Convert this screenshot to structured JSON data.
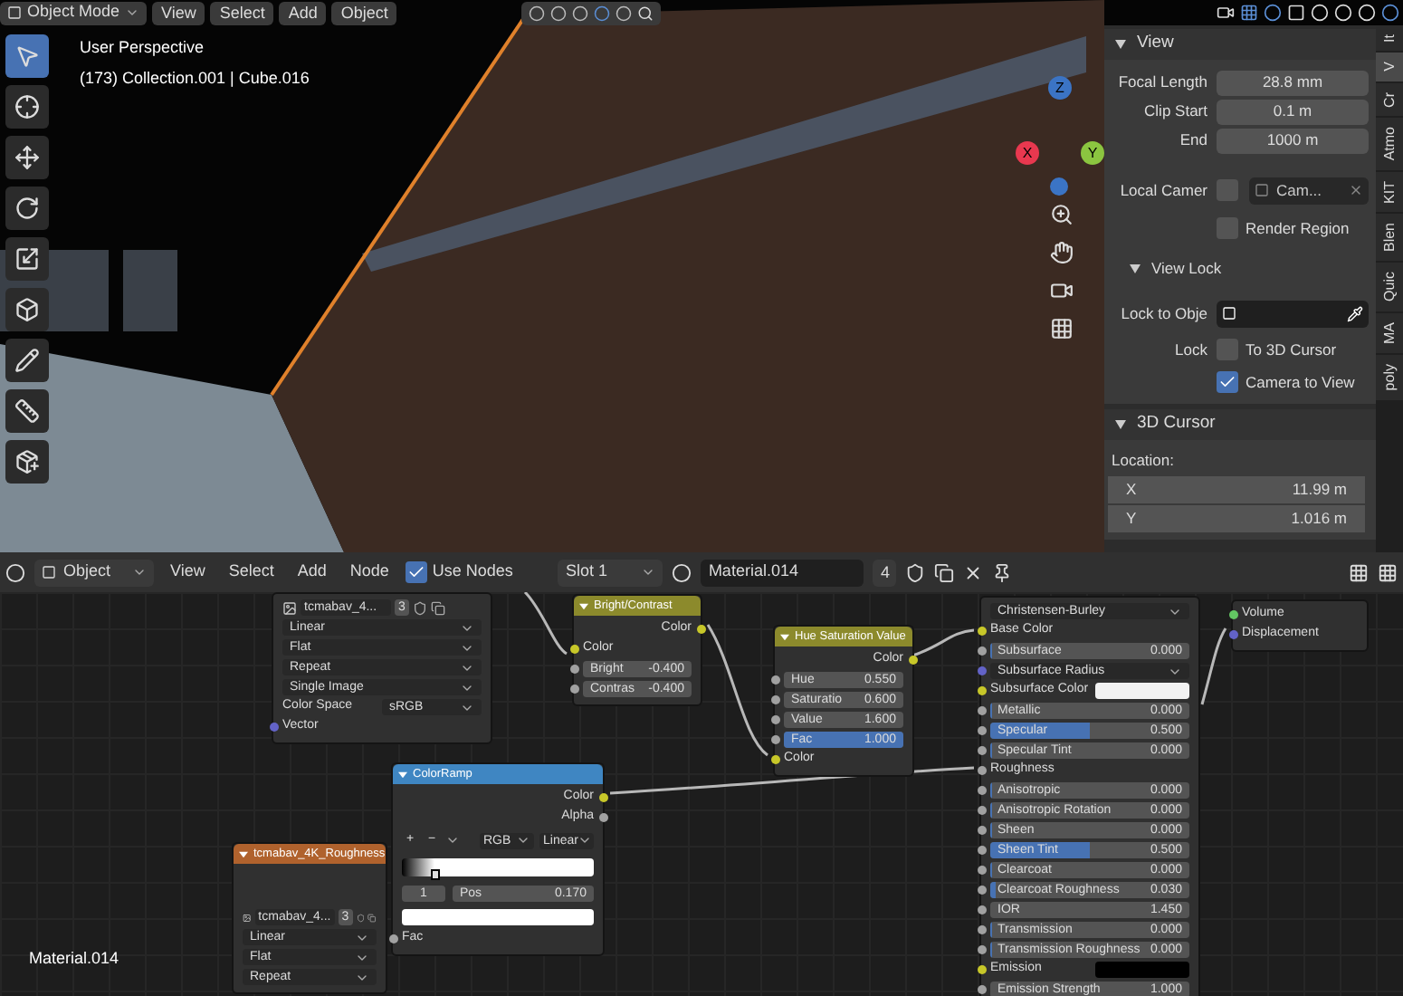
{
  "viewport_header": {
    "mode": "Object Mode",
    "menus": [
      "View",
      "Select",
      "Add",
      "Object"
    ]
  },
  "viewport": {
    "perspective": "User Perspective",
    "context": "(173) Collection.001 | Cube.016",
    "gizmo": [
      "X",
      "Y",
      "Z"
    ]
  },
  "tools": [
    {
      "selected": true
    },
    {
      "selected": false
    },
    {
      "selected": false
    },
    {
      "selected": false
    },
    {
      "selected": false
    },
    {
      "selected": false
    },
    {
      "selected": false
    },
    {
      "selected": false
    },
    {
      "selected": false
    }
  ],
  "sidebar": {
    "panels": [
      {
        "title": "View",
        "expanded": true,
        "rows": [
          {
            "kind": "number",
            "label": "Focal Length",
            "value": "28.8 mm"
          },
          {
            "kind": "number",
            "label": "Clip Start",
            "value": "0.1 m"
          },
          {
            "kind": "number",
            "label": "End",
            "value": "1000 m"
          },
          {
            "kind": "object",
            "label": "Local Camer",
            "checked": false,
            "value": "Cam..."
          },
          {
            "kind": "check",
            "text": "Render Region",
            "checked": false
          },
          {
            "kind": "subpanel",
            "title": "View Lock",
            "expanded": true
          },
          {
            "kind": "picker",
            "label": "Lock to Obje"
          },
          {
            "kind": "check",
            "label": "Lock",
            "text": "To 3D Cursor",
            "checked": false
          },
          {
            "kind": "check",
            "text": "Camera to View",
            "checked": true
          }
        ]
      },
      {
        "title": "3D Cursor",
        "expanded": true,
        "rows": [
          {
            "kind": "heading",
            "label": "Location:"
          },
          {
            "kind": "vector",
            "label": "X",
            "value": "11.99 m"
          },
          {
            "kind": "vector",
            "label": "Y",
            "value": "1.016 m"
          }
        ]
      }
    ],
    "tabs": [
      {
        "label": "It",
        "selected": false
      },
      {
        "label": "V",
        "selected": true
      },
      {
        "label": "Cr",
        "selected": false
      },
      {
        "label": "Atmo",
        "selected": false
      },
      {
        "label": "KIT",
        "selected": false
      },
      {
        "label": "Blen",
        "selected": false
      },
      {
        "label": "Quic",
        "selected": false
      },
      {
        "label": "MA",
        "selected": false
      },
      {
        "label": "poly",
        "selected": false
      }
    ]
  },
  "node_header": {
    "mode": "Object",
    "menus": [
      "View",
      "Select",
      "Add",
      "Node"
    ],
    "use_nodes": {
      "label": "Use Nodes",
      "checked": true
    },
    "slot": "Slot 1",
    "material": "Material.014",
    "users": "4"
  },
  "nodes": [
    {
      "rows": [
        {
          "kind": "image",
          "value": "tcmabav_4...",
          "users": "3"
        },
        {
          "kind": "dropdown",
          "value": "Linear"
        },
        {
          "kind": "dropdown",
          "value": "Flat"
        },
        {
          "kind": "dropdown",
          "value": "Repeat"
        },
        {
          "kind": "dropdown",
          "value": "Single Image"
        },
        {
          "kind": "dropdown",
          "label": "Color Space",
          "value": "sRGB"
        },
        {
          "kind": "input",
          "label": "Vector",
          "color": "#6363c7"
        }
      ]
    },
    {
      "title": "Bright/Contrast",
      "color": "#8c8a2c",
      "rows": [
        {
          "kind": "output",
          "label": "Color",
          "color": "#c7c729"
        },
        {
          "kind": "input",
          "label": "Color",
          "color": "#c7c729"
        },
        {
          "kind": "value",
          "label": "Bright",
          "value": "-0.400",
          "color": "#a1a1a1"
        },
        {
          "kind": "value",
          "label": "Contras",
          "value": "-0.400",
          "color": "#a1a1a1"
        }
      ]
    },
    {
      "title": "Hue Saturation Value",
      "color": "#8c8a2c",
      "rows": [
        {
          "kind": "output",
          "label": "Color",
          "color": "#c7c729"
        },
        {
          "kind": "value",
          "label": "Hue",
          "value": "0.550",
          "color": "#a1a1a1"
        },
        {
          "kind": "value",
          "label": "Saturatio",
          "value": "0.600",
          "color": "#a1a1a1"
        },
        {
          "kind": "value",
          "label": "Value",
          "value": "1.600",
          "color": "#a1a1a1"
        },
        {
          "kind": "value",
          "label": "Fac",
          "value": "1.000",
          "color": "#a1a1a1",
          "level": 1
        },
        {
          "kind": "input",
          "label": "Color",
          "color": "#c7c729"
        }
      ]
    },
    {
      "rows": [
        {
          "kind": "dropdown",
          "value": "Christensen-Burley"
        },
        {
          "kind": "input",
          "label": "Base Color",
          "color": "#c7c729"
        },
        {
          "kind": "value",
          "label": "Subsurface",
          "value": "0.000",
          "color": "#a1a1a1",
          "level": 0
        },
        {
          "kind": "dropdown",
          "label": "Subsurface Radius",
          "color": "#6363c7"
        },
        {
          "kind": "color_input",
          "label": "Subsurface Color",
          "color": "#c7c729",
          "swatch": {
            "color": "#f2f2f2"
          }
        },
        {
          "kind": "value",
          "label": "Metallic",
          "value": "0.000",
          "color": "#a1a1a1",
          "level": 0
        },
        {
          "kind": "value",
          "label": "Specular",
          "value": "0.500",
          "color": "#a1a1a1",
          "level": 0.5
        },
        {
          "kind": "value",
          "label": "Specular Tint",
          "value": "0.000",
          "color": "#a1a1a1",
          "level": 0
        },
        {
          "kind": "input",
          "label": "Roughness",
          "color": "#a1a1a1"
        },
        {
          "kind": "value",
          "label": "Anisotropic",
          "value": "0.000",
          "color": "#a1a1a1",
          "level": 0
        },
        {
          "kind": "value",
          "label": "Anisotropic Rotation",
          "value": "0.000",
          "color": "#a1a1a1",
          "level": 0
        },
        {
          "kind": "value",
          "label": "Sheen",
          "value": "0.000",
          "color": "#a1a1a1",
          "level": 0
        },
        {
          "kind": "value",
          "label": "Sheen Tint",
          "value": "0.500",
          "color": "#a1a1a1",
          "level": 0.5
        },
        {
          "kind": "value",
          "label": "Clearcoat",
          "value": "0.000",
          "color": "#a1a1a1",
          "level": 0
        },
        {
          "kind": "value",
          "label": "Clearcoat Roughness",
          "value": "0.030",
          "color": "#a1a1a1",
          "level": 0.03
        },
        {
          "kind": "value",
          "label": "IOR",
          "value": "1.450",
          "color": "#a1a1a1"
        },
        {
          "kind": "value",
          "label": "Transmission",
          "value": "0.000",
          "color": "#a1a1a1",
          "level": 0
        },
        {
          "kind": "value",
          "label": "Transmission Roughness",
          "value": "0.000",
          "color": "#a1a1a1",
          "level": 0
        },
        {
          "kind": "color_input",
          "label": "Emission",
          "color": "#c7c729",
          "swatch": {
            "color": "#000000"
          }
        },
        {
          "kind": "value",
          "label": "Emission Strength",
          "value": "1.000",
          "color": "#a1a1a1"
        }
      ]
    },
    {
      "rows": [
        {
          "kind": "input",
          "label": "Volume",
          "color": "#63c763"
        },
        {
          "kind": "input",
          "label": "Displacement",
          "color": "#6363c7"
        }
      ]
    },
    {
      "title": "tcmabav_4K_Roughness",
      "color": "#b0622d",
      "rows": [
        {
          "kind": "gap"
        },
        {
          "kind": "image",
          "value": "tcmabav_4...",
          "users": "3"
        },
        {
          "kind": "dropdown",
          "value": "Linear"
        },
        {
          "kind": "dropdown",
          "value": "Flat"
        },
        {
          "kind": "dropdown",
          "value": "Repeat"
        }
      ]
    },
    {
      "title": "ColorRamp",
      "color": "#3f86c2",
      "rows": [
        {
          "kind": "output",
          "label": "Color",
          "color": "#c7c729"
        },
        {
          "kind": "output",
          "label": "Alpha",
          "color": "#a1a1a1"
        },
        {
          "kind": "ramp_tools",
          "tools": [
            "+",
            "−"
          ],
          "mode": "RGB",
          "interp": "Linear"
        },
        {
          "kind": "ramp",
          "level": 0.17
        },
        {
          "kind": "stop",
          "index": "1",
          "label": "Pos",
          "value": "0.170"
        },
        {
          "kind": "swatch",
          "color": "#ffffff"
        },
        {
          "kind": "input",
          "label": "Fac",
          "color": "#a1a1a1"
        }
      ]
    }
  ],
  "canvas_label": "Material.014"
}
